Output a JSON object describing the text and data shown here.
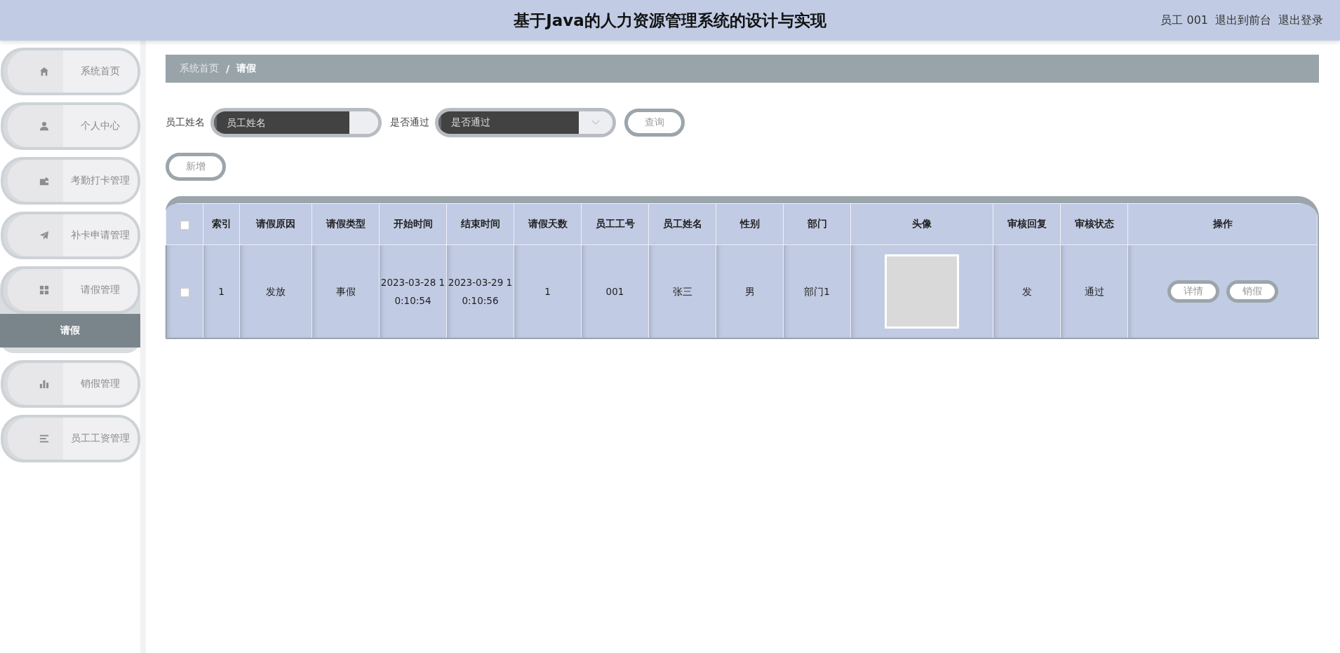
{
  "header": {
    "title": "基于Java的人力资源管理系统的设计与实现",
    "user": "员工 001",
    "links": [
      "退出到前台",
      "退出登录"
    ]
  },
  "sidebar": {
    "items": [
      {
        "kind": "home",
        "label": "系统首页",
        "expanded": false
      },
      {
        "kind": "person",
        "label": "个人中心",
        "expanded": false
      },
      {
        "kind": "wallet",
        "label": "考勤打卡管理",
        "expanded": false
      },
      {
        "kind": "plane",
        "label": "补卡申请管理",
        "expanded": false
      },
      {
        "kind": "grid",
        "label": "请假管理",
        "expanded": true,
        "children": [
          {
            "label": "请假",
            "selected": true
          }
        ]
      },
      {
        "kind": "bars",
        "label": "销假管理",
        "expanded": false
      },
      {
        "kind": "list",
        "label": "员工工资管理",
        "expanded": false
      }
    ]
  },
  "breadcrumb": [
    "系统首页",
    "/",
    "请假"
  ],
  "search": {
    "fields": [
      {
        "kind": "input",
        "label": "员工姓名",
        "placeholder": "员工姓名"
      },
      {
        "kind": "select",
        "label": "是否通过",
        "placeholder": "是否通过"
      }
    ],
    "button": "查询"
  },
  "add_button": "新增",
  "table": {
    "select_all_checked": false,
    "columns": [
      "索引",
      "请假原因",
      "请假类型",
      "开始时间",
      "结束时间",
      "请假天数",
      "员工工号",
      "员工姓名",
      "性别",
      "部门",
      "头像",
      "审核回复",
      "审核状态",
      "操作"
    ],
    "rows": [
      {
        "checked": false,
        "cells": [
          "1",
          "发放",
          "事假",
          "2023-03-28 10:10:54",
          "2023-03-29 10:10:56",
          "1",
          "001",
          "张三",
          "男",
          "部门1"
        ],
        "reply": "发",
        "status": "通过",
        "actions": [
          "详情",
          "销假"
        ]
      }
    ]
  }
}
